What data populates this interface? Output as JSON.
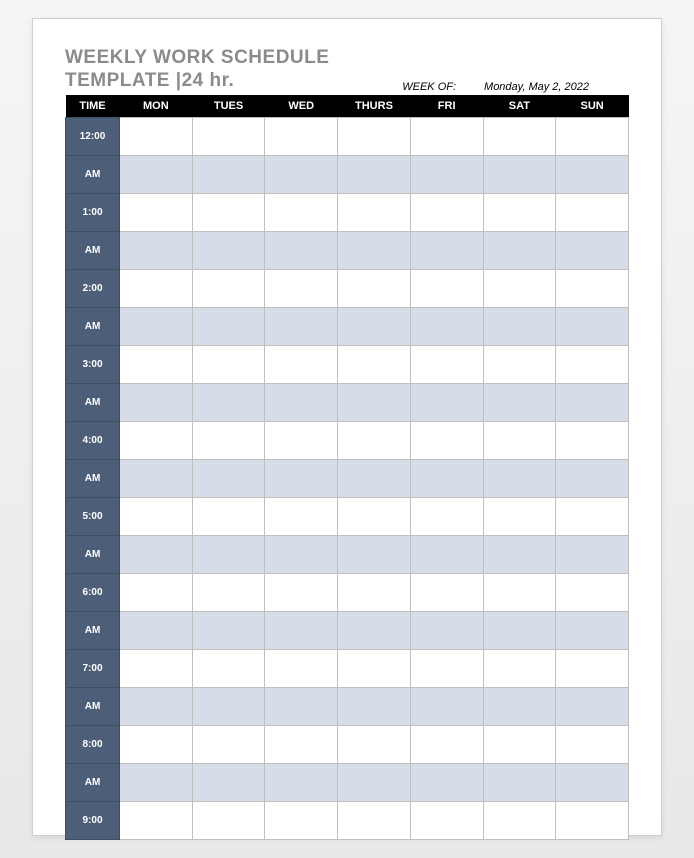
{
  "title": {
    "line1": "WEEKLY WORK SCHEDULE",
    "line2_prefix": "TEMPLATE |",
    "line2_variant": "24 hr."
  },
  "week_of": {
    "label": "WEEK OF:",
    "value": "Monday, May 2, 2022"
  },
  "headers": [
    "TIME",
    "MON",
    "TUES",
    "WED",
    "THURS",
    "FRI",
    "SAT",
    "SUN"
  ],
  "time_rows": [
    "12:00",
    "AM",
    "1:00",
    "AM",
    "2:00",
    "AM",
    "3:00",
    "AM",
    "4:00",
    "AM",
    "5:00",
    "AM",
    "6:00",
    "AM",
    "7:00",
    "AM",
    "8:00",
    "AM",
    "9:00"
  ],
  "chart_data": {
    "type": "table",
    "title": "Weekly Work Schedule Template 24 hr.",
    "week_of": "Monday, May 2, 2022",
    "columns": [
      "TIME",
      "MON",
      "TUES",
      "WED",
      "THURS",
      "FRI",
      "SAT",
      "SUN"
    ],
    "time_slots": [
      "12:00 AM",
      "1:00 AM",
      "2:00 AM",
      "3:00 AM",
      "4:00 AM",
      "5:00 AM",
      "6:00 AM",
      "7:00 AM",
      "8:00 AM",
      "9:00"
    ],
    "cells": "empty"
  }
}
